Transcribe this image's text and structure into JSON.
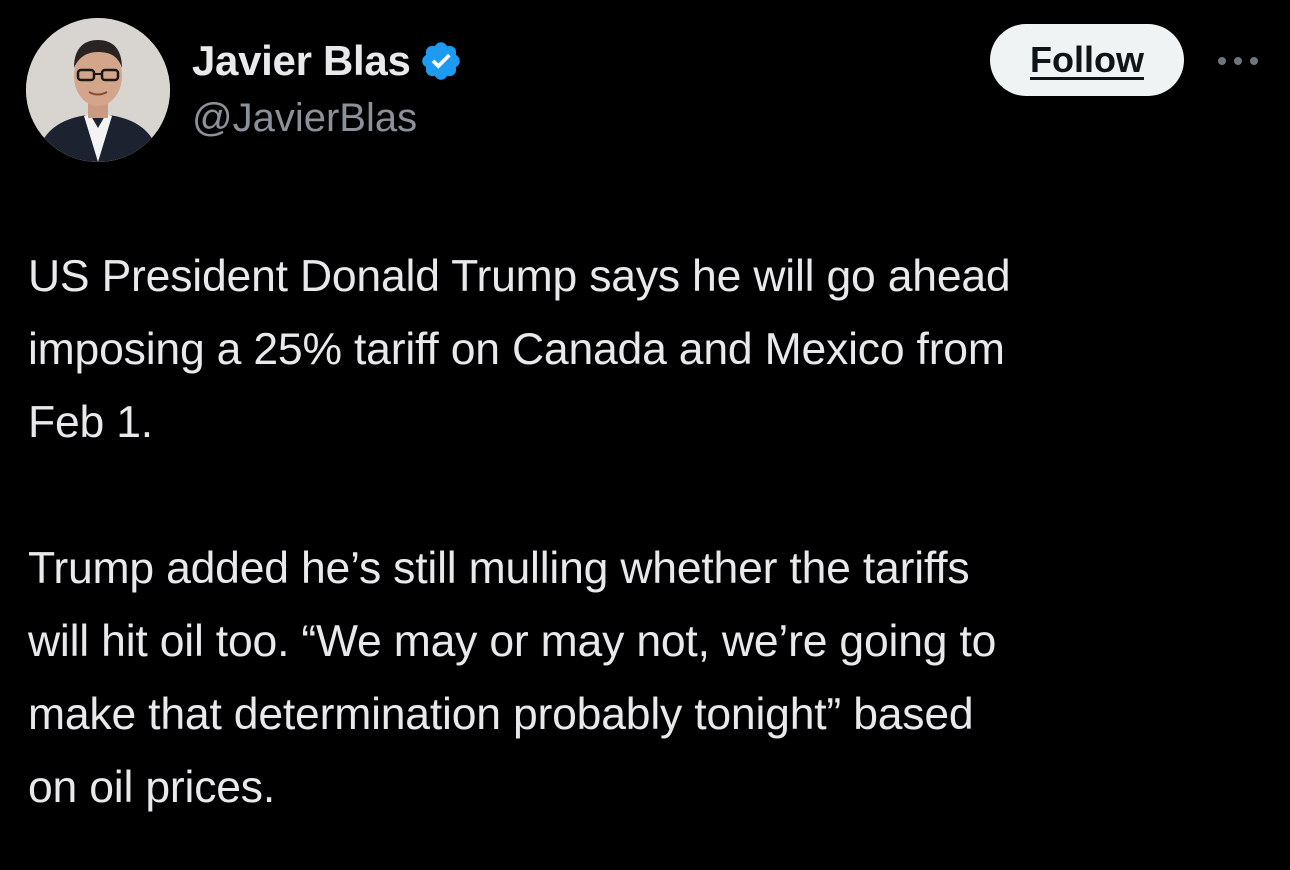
{
  "author": {
    "display_name": "Javier Blas",
    "handle": "@JavierBlas",
    "verified_icon": "verified-badge-icon",
    "avatar": "profile-photo"
  },
  "actions": {
    "follow_label": "Follow",
    "more_icon": "more-options-icon"
  },
  "tweet": {
    "paragraphs": [
      {
        "lines": [
          "US President Donald Trump says he will go ahead",
          "imposing a 25% tariff on Canada and Mexico from",
          "Feb 1."
        ]
      },
      {
        "lines": [
          "Trump added he’s still mulling whether the tariffs",
          "will hit oil too. “We may or may not, we’re going to",
          "make that determination probably tonight” based",
          "on oil prices."
        ]
      }
    ]
  },
  "colors": {
    "background": "#000000",
    "text_primary": "#e7e9ea",
    "text_secondary": "#8b9198",
    "verified_blue": "#1d9bf0",
    "follow_bg": "#eff3f4"
  }
}
